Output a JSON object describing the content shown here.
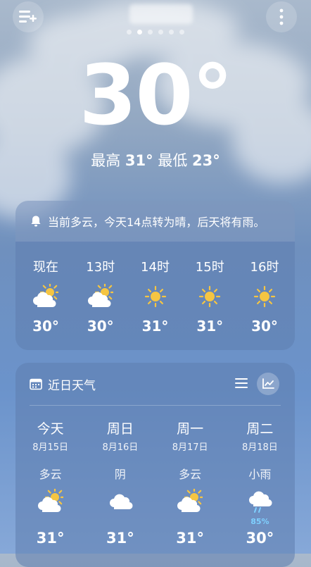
{
  "header": {
    "city": "",
    "page_count": 6,
    "active_page": 1
  },
  "current": {
    "temperature": "30°",
    "high_label": "最高",
    "high": "31°",
    "low_label": "最低",
    "low": "23°"
  },
  "alert": {
    "text": "当前多云，今天14点转为晴，后天将有雨。",
    "icon": "bell-icon"
  },
  "hourly": [
    {
      "label": "现在",
      "icon": "partly-cloudy-icon",
      "temp": "30°"
    },
    {
      "label": "13时",
      "icon": "partly-cloudy-icon",
      "temp": "30°"
    },
    {
      "label": "14时",
      "icon": "sunny-icon",
      "temp": "31°"
    },
    {
      "label": "15时",
      "icon": "sunny-icon",
      "temp": "31°"
    },
    {
      "label": "16时",
      "icon": "sunny-icon",
      "temp": "30°"
    }
  ],
  "forecast": {
    "title": "近日天气",
    "days": [
      {
        "name": "今天",
        "date": "8月15日",
        "cond": "多云",
        "icon": "partly-cloudy-icon",
        "pop": "",
        "temp": "31°"
      },
      {
        "name": "周日",
        "date": "8月16日",
        "cond": "阴",
        "icon": "cloud-icon",
        "pop": "",
        "temp": "31°"
      },
      {
        "name": "周一",
        "date": "8月17日",
        "cond": "多云",
        "icon": "partly-cloudy-icon",
        "pop": "",
        "temp": "31°"
      },
      {
        "name": "周二",
        "date": "8月18日",
        "cond": "小雨",
        "icon": "rain-icon",
        "pop": "85%",
        "temp": "30°"
      }
    ]
  },
  "colors": {
    "sun": "#f5c542",
    "cloud": "#ffffff",
    "pop": "#7fd0ff"
  }
}
